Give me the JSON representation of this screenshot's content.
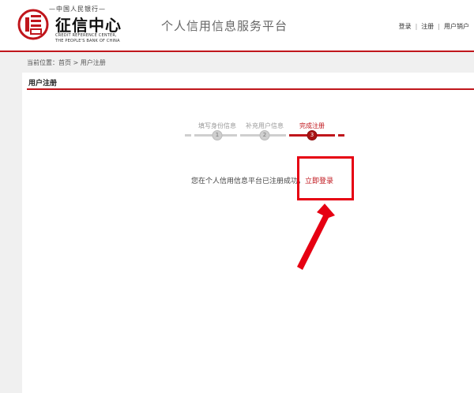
{
  "header": {
    "logo_top": "—中国人民银行—",
    "logo_title": "征信中心",
    "logo_en_line1": "CREDIT REFERENCE CENTER,",
    "logo_en_line2": "THE PEOPLE'S BANK OF CHINA",
    "site_title": "个人信用信息服务平台",
    "nav": {
      "login": "登录",
      "register": "注册",
      "cancel_account": "用户销户"
    }
  },
  "breadcrumb": "当前位置：首页 > 用户注册",
  "panel": {
    "title": "用户注册"
  },
  "steps": [
    {
      "label": "填写身份信息",
      "number": "1",
      "active": false
    },
    {
      "label": "补充用户信息",
      "number": "2",
      "active": false
    },
    {
      "label": "完成注册",
      "number": "3",
      "active": true
    }
  ],
  "result": {
    "message": "您在个人信用信息平台已注册成功，",
    "login_now": "立即登录"
  },
  "colors": {
    "brand_red": "#c0161c",
    "annotation_red": "#e60012"
  }
}
